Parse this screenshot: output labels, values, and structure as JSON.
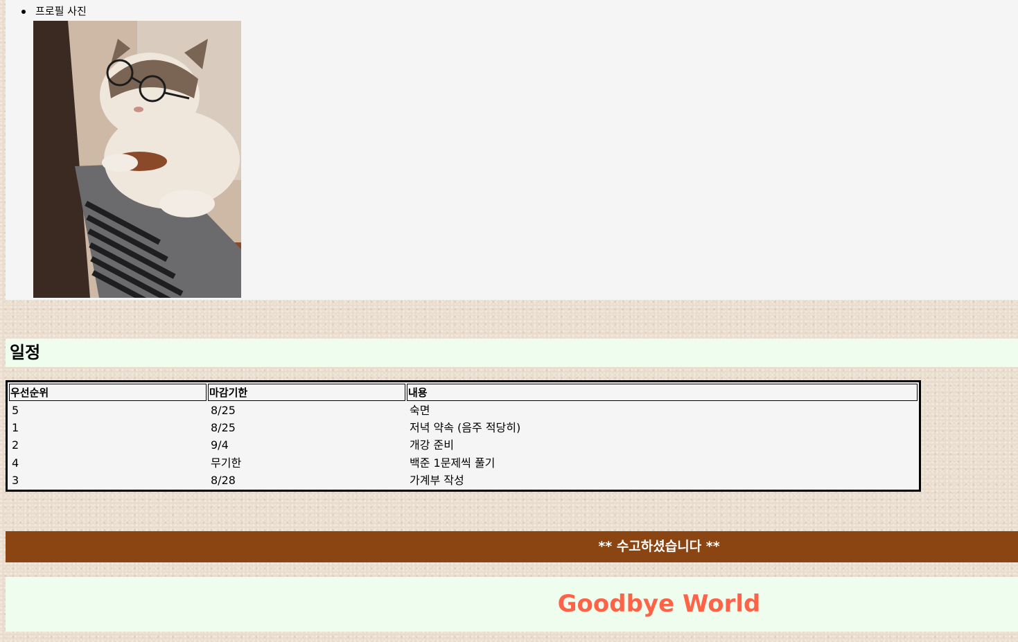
{
  "profile": {
    "label": "프로필 사진"
  },
  "schedule": {
    "title": "일정",
    "columns": [
      "우선순위",
      "마감기한",
      "내용"
    ],
    "rows": [
      [
        "5",
        "8/25",
        "숙면"
      ],
      [
        "1",
        "8/25",
        "저녁 약속 (음주 적당히)"
      ],
      [
        "2",
        "9/4",
        "개강 준비"
      ],
      [
        "4",
        "무기한",
        "백준 1문제씩 풀기"
      ],
      [
        "3",
        "8/28",
        "가계부 작성"
      ]
    ]
  },
  "footer": {
    "message": "** 수고하셨습니다 **"
  },
  "goodbye": {
    "text": "Goodbye World",
    "color": "#ff6347"
  },
  "colors": {
    "footer_bg": "#8b4513",
    "header_bg": "#effdef",
    "section_bg": "#f5f5f5"
  }
}
